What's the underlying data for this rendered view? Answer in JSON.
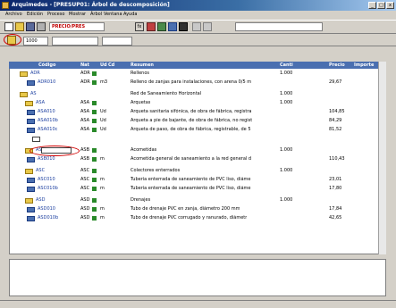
{
  "window": {
    "title": "Arquimedes - [PRESUP01: Árbol de descomposición]",
    "controls": [
      "_",
      "□",
      "x"
    ]
  },
  "menu": [
    "Archivo",
    "Edición",
    "Proceso",
    "Mostrar",
    "Árbol",
    "Ventana",
    "Ayuda"
  ],
  "toolbar": {
    "combo_value": "PRECIO/PRES",
    "misc_glyph": "fx",
    "code_field": "1000"
  },
  "grid": {
    "headers": [
      "Código",
      "Nat",
      "Ud",
      "Cd",
      "Resumen",
      "Canti",
      "Precio",
      "Importe"
    ],
    "rows": [
      {
        "kind": "folder",
        "code": "ADR",
        "nat": "ADR",
        "ud": "",
        "cd": "",
        "resumen": "Rellenos",
        "canti": "1.000",
        "precio": "",
        "importe": ""
      },
      {
        "kind": "doc",
        "code": "ADR010",
        "nat": "ADR",
        "ud": "m3",
        "cd": "",
        "resumen": "Relleno de zanjas para instalaciones, con arena 0/5 m",
        "canti": "",
        "precio": "29,67",
        "importe": ""
      },
      {
        "kind": "folder",
        "code": "AS",
        "nat": "",
        "ud": "",
        "cd": "",
        "resumen": "Red de Saneamiento Horizontal",
        "canti": "1.000",
        "precio": "",
        "importe": ""
      },
      {
        "kind": "folder",
        "code": "ASA",
        "nat": "ASA",
        "ud": "",
        "cd": "",
        "resumen": "Arquetas",
        "canti": "1.000",
        "precio": "",
        "importe": ""
      },
      {
        "kind": "doc",
        "code": "ASA010",
        "nat": "ASA",
        "ud": "Ud",
        "cd": "",
        "resumen": "Arqueta sanitaria sifónica, de obra de fábrica, registra",
        "canti": "",
        "precio": "104,85",
        "importe": ""
      },
      {
        "kind": "doc",
        "code": "ASA010b",
        "nat": "ASA",
        "ud": "Ud",
        "cd": "",
        "resumen": "Arqueta a pie de bajante, de obra de fábrica, no regist",
        "canti": "",
        "precio": "84,29",
        "importe": ""
      },
      {
        "kind": "doc",
        "code": "ASA010c",
        "nat": "ASA",
        "ud": "Ud",
        "cd": "",
        "resumen": "Arqueta de paso, de obra de fábrica, registrable, de 5",
        "canti": "",
        "precio": "81,52",
        "importe": ""
      },
      {
        "kind": "edit",
        "code": "",
        "nat": "",
        "ud": "",
        "cd": "",
        "resumen": "",
        "canti": "",
        "precio": "",
        "importe": ""
      },
      {
        "kind": "folder",
        "code": "ASB",
        "nat": "ASB",
        "ud": "",
        "cd": "",
        "resumen": "Acometidas",
        "canti": "1.000",
        "precio": "",
        "importe": ""
      },
      {
        "kind": "doc",
        "code": "ASB010",
        "nat": "ASB",
        "ud": "m",
        "cd": "",
        "resumen": "Acometida general de saneamiento a la red general d",
        "canti": "",
        "precio": "110,43",
        "importe": ""
      },
      {
        "kind": "folder",
        "code": "ASC",
        "nat": "ASC",
        "ud": "",
        "cd": "",
        "resumen": "Colectores enterrados",
        "canti": "1.000",
        "precio": "",
        "importe": ""
      },
      {
        "kind": "doc",
        "code": "ASC010",
        "nat": "ASC",
        "ud": "m",
        "cd": "",
        "resumen": "Tubería enterrada de saneamiento de PVC liso, diáme",
        "canti": "",
        "precio": "23,01",
        "importe": ""
      },
      {
        "kind": "doc",
        "code": "ASC010b",
        "nat": "ASC",
        "ud": "m",
        "cd": "",
        "resumen": "Tubería enterrada de saneamiento de PVC liso, diáme",
        "canti": "",
        "precio": "17,80",
        "importe": ""
      },
      {
        "kind": "folder",
        "code": "ASD",
        "nat": "ASD",
        "ud": "",
        "cd": "",
        "resumen": "Drenajes",
        "canti": "1.000",
        "precio": "",
        "importe": ""
      },
      {
        "kind": "doc",
        "code": "ASD010",
        "nat": "ASD",
        "ud": "m",
        "cd": "",
        "resumen": "Tubo de drenaje PVC en zanja, diámetro 200 mm",
        "canti": "",
        "precio": "17,84",
        "importe": ""
      },
      {
        "kind": "doc",
        "code": "ASD010b",
        "nat": "ASD",
        "ud": "m",
        "cd": "",
        "resumen": "Tubo de drenaje PVC corrugado y ranurado, diámetr",
        "canti": "",
        "precio": "42,65",
        "importe": ""
      }
    ]
  }
}
